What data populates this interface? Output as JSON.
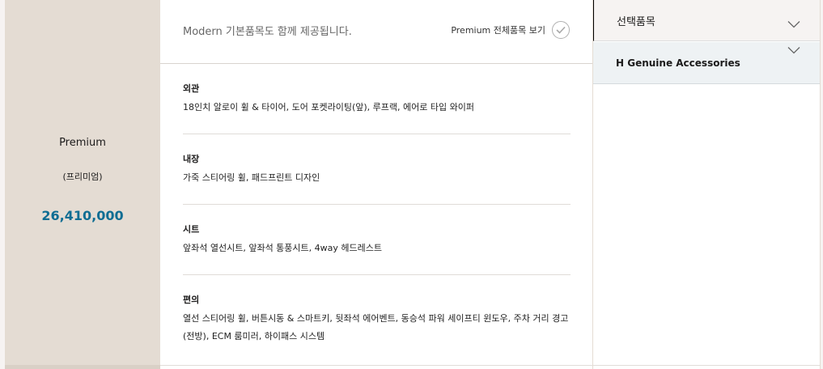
{
  "trim": {
    "name": "Premium",
    "subtitle": "(프리미엄)",
    "price": "26,410,000"
  },
  "header": {
    "note": "Modern 기본품목도 함께 제공됩니다.",
    "view_all_label": "Premium 전체품목 보기"
  },
  "specs": [
    {
      "title": "외관",
      "text": "18인치 알로이 휠 & 타이어, 도어 포켓라이팅(앞), 루프랙, 에어로 타입 와이퍼"
    },
    {
      "title": "내장",
      "text": "가죽 스티어링 휠, 패드프린트 디자인"
    },
    {
      "title": "시트",
      "text": "앞좌석 열선시트, 앞좌석 통풍시트, 4way 헤드레스트"
    },
    {
      "title": "편의",
      "text": "열선 스티어링 휠, 버튼시동 & 스마트키, 뒷좌석 에어벤트, 동승석 파워 세이프티 윈도우, 주차 거리 경고(전방), ECM 룸미러, 하이패스 시스템"
    }
  ],
  "accordion": {
    "selected_options": "선택품목",
    "genuine_accessories": "H Genuine Accessories"
  },
  "colors": {
    "trim_bg": "#e4dcd3",
    "price": "#0e6d93",
    "accessories_bg": "#eef2f4"
  }
}
